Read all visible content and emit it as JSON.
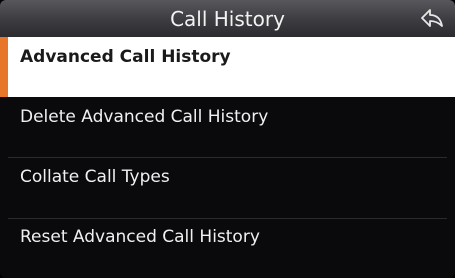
{
  "header": {
    "title": "Call History",
    "back_icon": "back-arrow-icon"
  },
  "menu": {
    "items": [
      {
        "label": "Advanced Call History",
        "selected": true
      },
      {
        "label": "Delete Advanced Call History",
        "selected": false
      },
      {
        "label": "Collate Call Types",
        "selected": false
      },
      {
        "label": "Reset Advanced Call History",
        "selected": false
      }
    ]
  },
  "colors": {
    "accent": "#e8762a",
    "selected_bg": "#ffffff",
    "background": "#0a0a0c"
  }
}
